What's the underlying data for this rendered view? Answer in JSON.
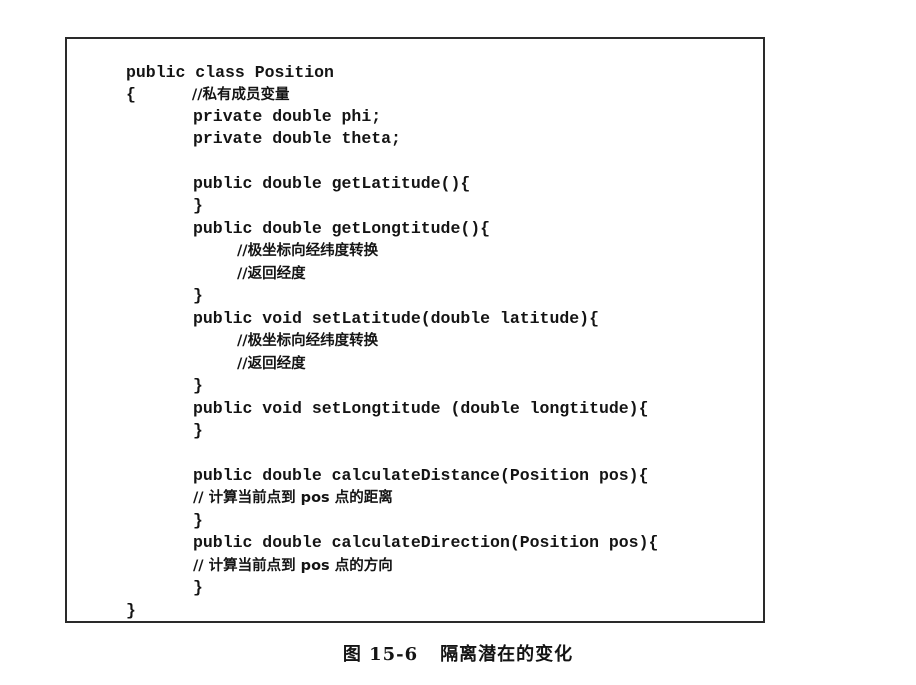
{
  "code_lines": [
    "public class Position",
    "{",
    "//私有成员变量",
    "private double phi;",
    "private double theta;",
    "",
    "public double getLatitude(){",
    "}",
    "public double getLongtitude(){",
    "//极坐标向经纬度转换",
    "//返回经度",
    "}",
    "public void setLatitude(double latitude){",
    "//极坐标向经纬度转换",
    "//返回经度",
    "}",
    "public void setLongtitude (double longtitude){",
    "}",
    "",
    "public double calculateDistance(Position pos){",
    "// 计算当前点到 pos 点的距离",
    "}",
    "public double calculateDirection(Position pos){",
    "// 计算当前点到 pos 点的方向",
    "}",
    "}"
  ],
  "caption": {
    "figure_number": "图 15-6",
    "title": "隔离潜在的变化"
  }
}
